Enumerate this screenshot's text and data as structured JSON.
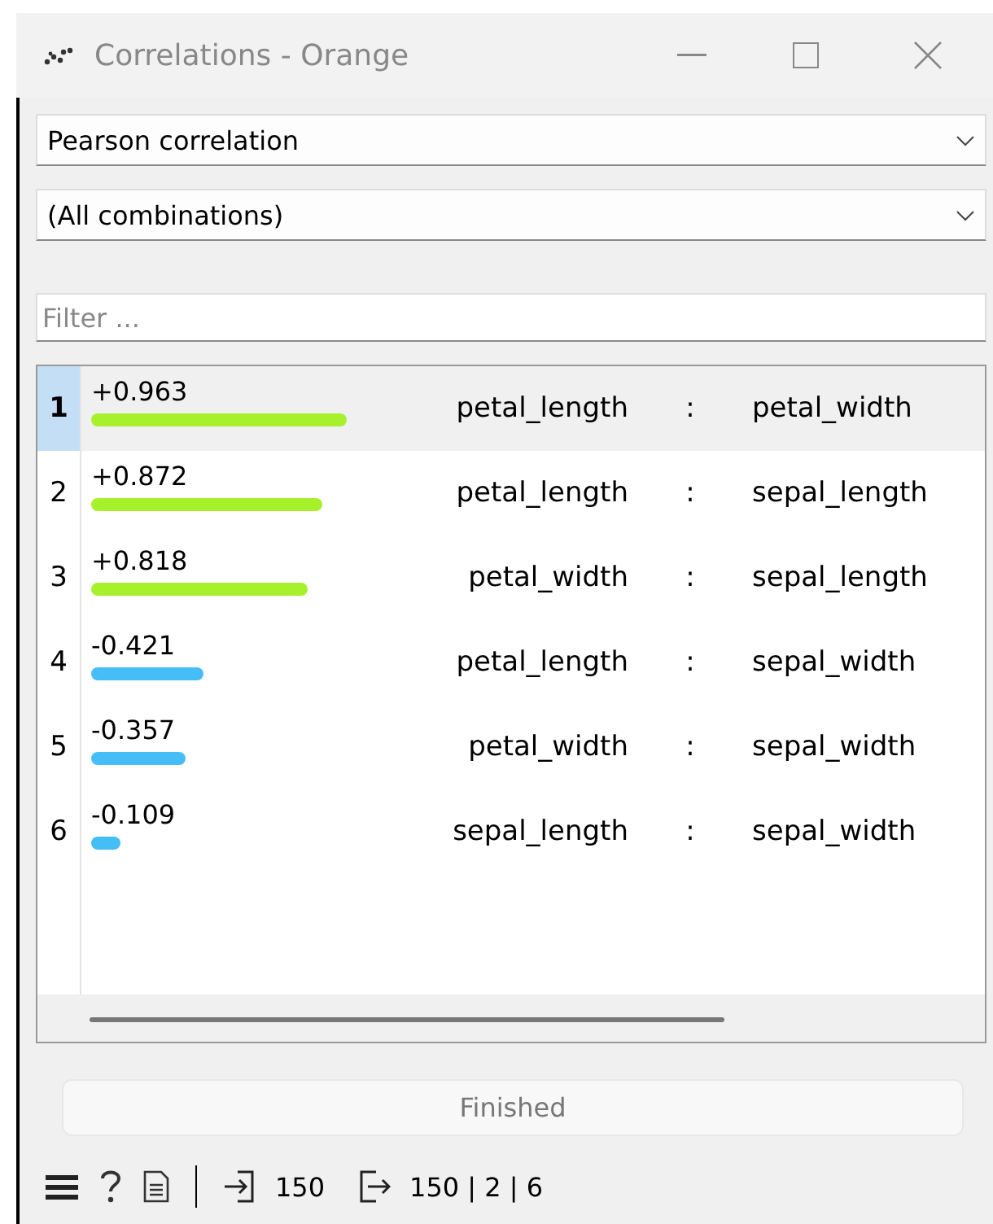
{
  "window": {
    "title": "Correlations - Orange"
  },
  "correlation_type": {
    "value": "Pearson correlation"
  },
  "feature_filter": {
    "value": "(All combinations)"
  },
  "filter": {
    "placeholder": "Filter ..."
  },
  "rows": [
    {
      "index": "1",
      "selected": true,
      "value": "+0.963",
      "level": 0.963,
      "color": "#a6f12c",
      "feature_1": "petal_length",
      "separator": ":",
      "feature_2": "petal_width"
    },
    {
      "index": "2",
      "selected": false,
      "value": "+0.872",
      "level": 0.872,
      "color": "#a6f12c",
      "feature_1": "petal_length",
      "separator": ":",
      "feature_2": "sepal_length"
    },
    {
      "index": "3",
      "selected": false,
      "value": "+0.818",
      "level": 0.818,
      "color": "#a6f12c",
      "feature_1": "petal_width",
      "separator": ":",
      "feature_2": "sepal_length"
    },
    {
      "index": "4",
      "selected": false,
      "value": "-0.421",
      "level": 0.421,
      "color": "#45bdf7",
      "feature_1": "petal_length",
      "separator": ":",
      "feature_2": "sepal_width"
    },
    {
      "index": "5",
      "selected": false,
      "value": "-0.357",
      "level": 0.357,
      "color": "#45bdf7",
      "feature_1": "petal_width",
      "separator": ":",
      "feature_2": "sepal_width"
    },
    {
      "index": "6",
      "selected": false,
      "value": "-0.109",
      "level": 0.109,
      "color": "#45bdf7",
      "feature_1": "sepal_length",
      "separator": ":",
      "feature_2": "sepal_width"
    }
  ],
  "status": {
    "label": "Finished"
  },
  "footer": {
    "input_count": "150",
    "output_count": "150 | 2 | 6"
  }
}
